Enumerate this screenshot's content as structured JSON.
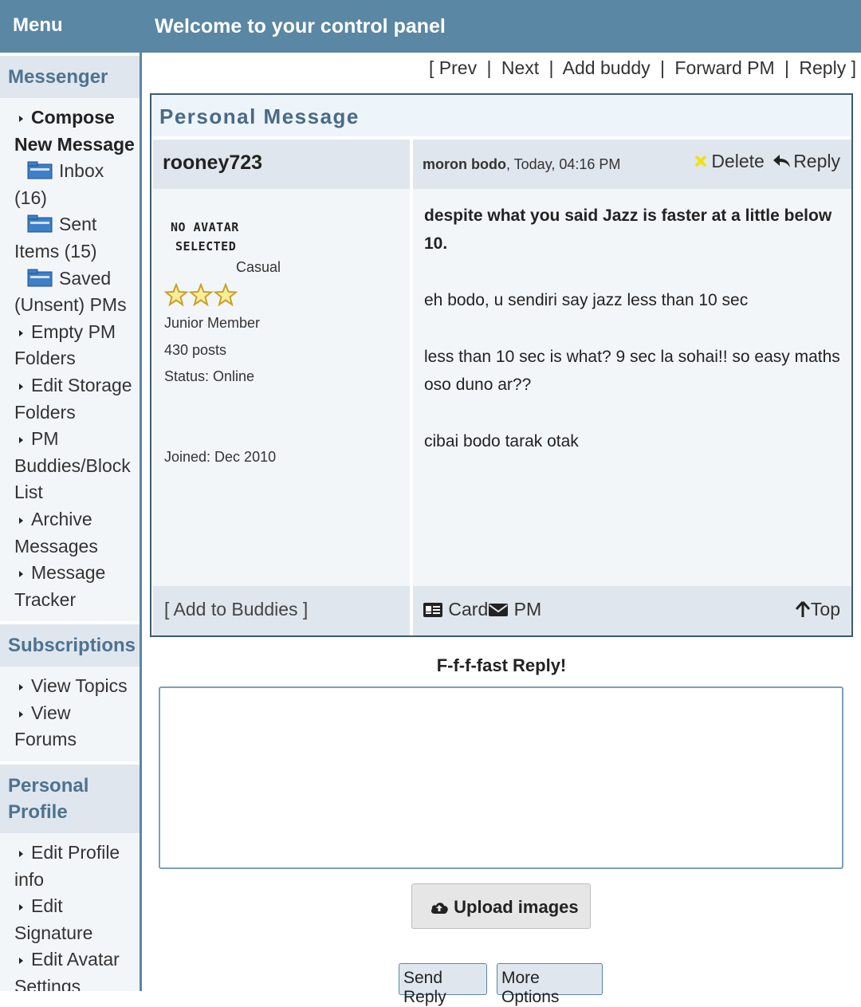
{
  "sidebar": {
    "menu_title": "Menu",
    "messenger": {
      "title": "Messenger",
      "compose": "Compose New Message",
      "inbox": "Inbox (16)",
      "sent": "Sent Items (15)",
      "saved": "Saved (Unsent) PMs",
      "empty": "Empty PM Folders",
      "edit_storage": "Edit Storage Folders",
      "buddies": "PM Buddies/Block List",
      "archive": "Archive Messages",
      "tracker": "Message Tracker"
    },
    "subscriptions": {
      "title": "Subscriptions",
      "view_topics": "View Topics",
      "view_forums": "View Forums"
    },
    "personal_profile": {
      "title": "Personal Profile",
      "edit_info": "Edit Profile info",
      "edit_signature": "Edit Signature",
      "edit_avatar": "Edit Avatar Settings"
    }
  },
  "header": {
    "title": "Welcome to your control panel"
  },
  "nav": {
    "open": "[",
    "prev": "Prev",
    "next": "Next",
    "add_buddy": "Add buddy",
    "forward": "Forward PM",
    "reply": "Reply",
    "close": "]",
    "sep": "|"
  },
  "pm": {
    "title": "Personal Message",
    "author": "rooney723",
    "subject": "moron bodo",
    "datetime": ", Today, 04:16 PM",
    "delete_label": "Delete",
    "reply_label": "Reply",
    "avatar_line1": "NO AVATAR",
    "avatar_line2": "SELECTED",
    "rank_title": "Casual",
    "member_group": "Junior Member",
    "posts": "430 posts",
    "status": "Status: Online",
    "joined": "Joined: Dec 2010",
    "stars": 3,
    "body": [
      "despite what you said Jazz is faster at a little below 10.",
      "eh bodo, u sendiri say jazz less than 10 sec",
      "less than 10 sec is what? 9 sec la sohai!! so easy maths oso duno ar??",
      "cibai bodo tarak otak"
    ],
    "add_to_buddies": "[ Add to Buddies ]",
    "card_label": "Card",
    "pm_label": "PM",
    "top_label": "Top"
  },
  "quick_reply": {
    "title": "F-f-f-fast Reply!",
    "text": "",
    "upload_label": "Upload images",
    "send_label": "Send Reply",
    "more_label": "More Options"
  }
}
